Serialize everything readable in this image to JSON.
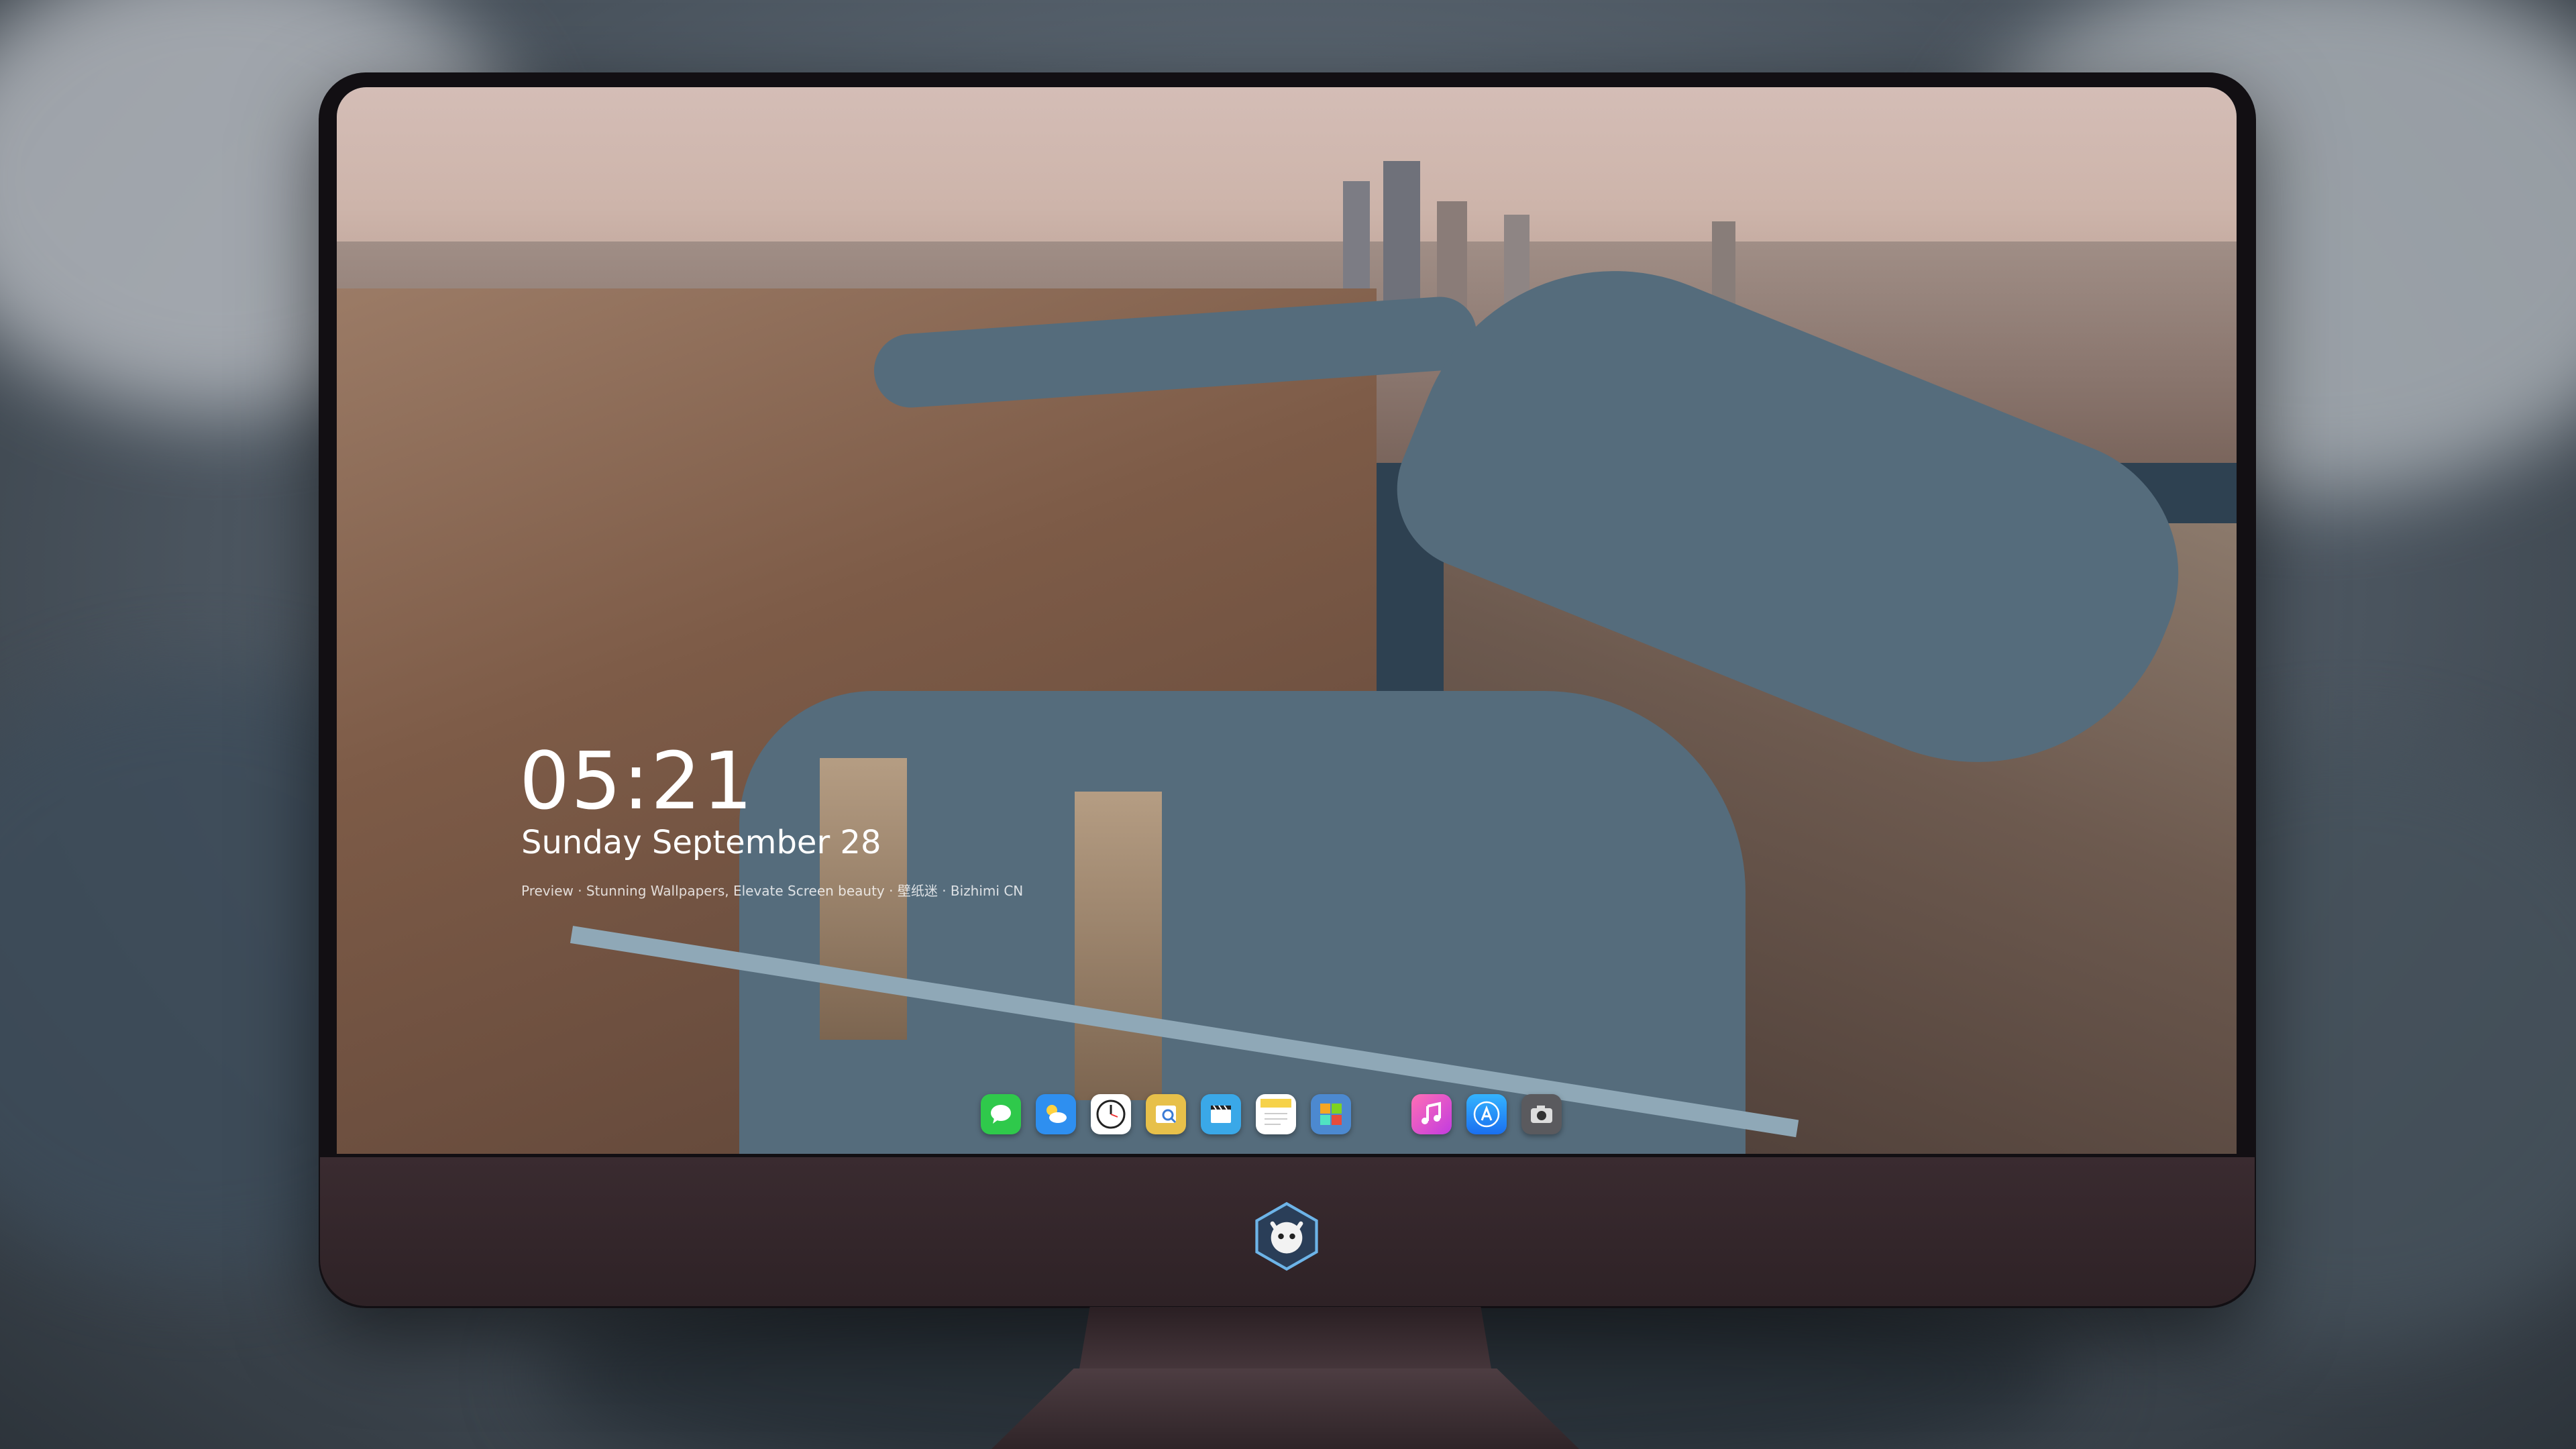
{
  "lockscreen": {
    "time": "05:21",
    "date": "Sunday September  28",
    "credit": "Preview · Stunning Wallpapers, Elevate Screen beauty · 壁纸迷 · Bizhimi CN"
  },
  "dock": {
    "apps": [
      {
        "icon": "messages-icon",
        "color": "#2fc94b"
      },
      {
        "icon": "weather-icon",
        "color": "#2e8ff0"
      },
      {
        "icon": "clock-icon",
        "color": "#ffffff"
      },
      {
        "icon": "preview-icon",
        "color": "#e7c04a"
      },
      {
        "icon": "clips-icon",
        "color": "#3aa8e8"
      },
      {
        "icon": "notes-icon",
        "color": "#f6d24a"
      },
      {
        "icon": "photo-booth-icon",
        "color": "#4c89d0"
      },
      {
        "icon": "music-icon",
        "color": "#f25ebd"
      },
      {
        "icon": "app-store-icon",
        "color": "#2c8cf5"
      },
      {
        "icon": "camera-icon",
        "color": "#5a5a5e"
      }
    ]
  },
  "brand": {
    "logo": "bizhimi-logo"
  }
}
